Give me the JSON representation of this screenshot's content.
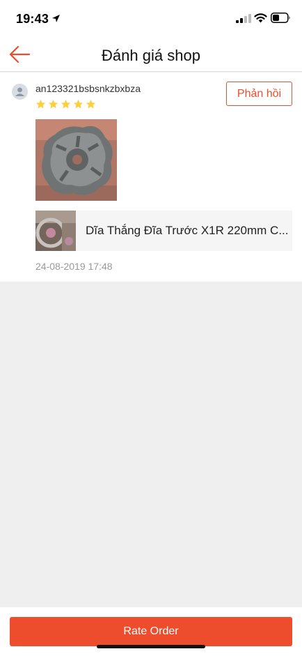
{
  "status_bar": {
    "time": "19:43",
    "icons": [
      "location-arrow-icon",
      "cellular-signal-icon",
      "wifi-icon",
      "battery-icon"
    ]
  },
  "nav": {
    "back_icon": "arrow-left-icon",
    "title": "Đánh giá shop"
  },
  "review": {
    "username": "an123321bsbsnkzbxbza",
    "rating": 5,
    "reply_label": "Phản hồi",
    "product_name": "Dĩa Thắng Đĩa Trước X1R 220mm C...",
    "date": "24-08-2019 17:48"
  },
  "footer": {
    "rate_order_label": "Rate Order"
  },
  "colors": {
    "accent": "#ee4d2d",
    "star": "#ffce3d",
    "background": "#efefef"
  }
}
